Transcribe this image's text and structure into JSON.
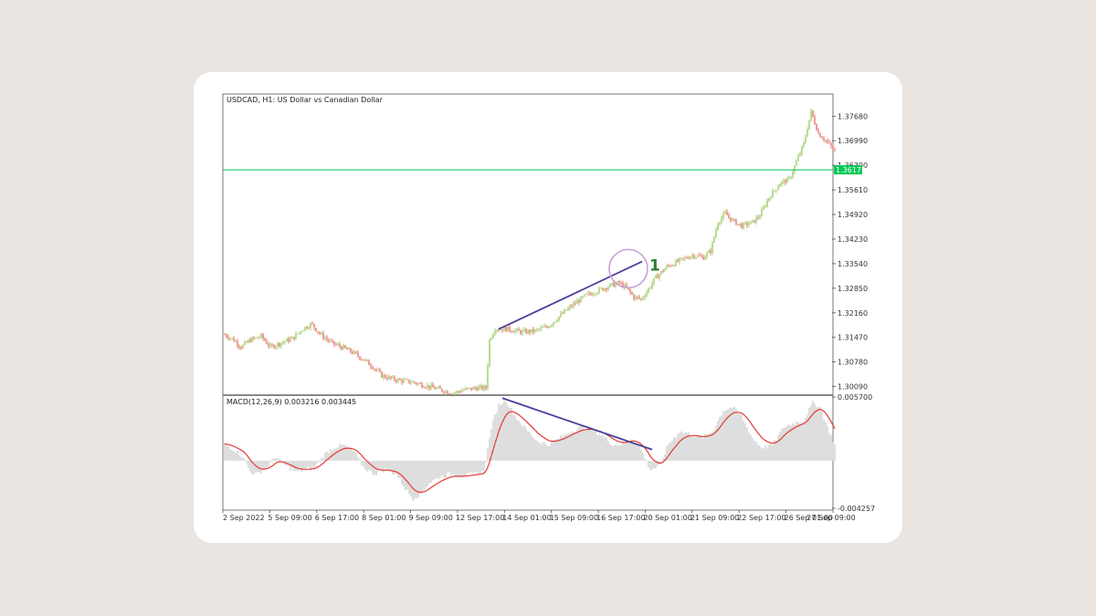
{
  "chart_data": [
    {
      "type": "candlestick",
      "title": "USDCAD, H1:  US Dollar vs Canadian Dollar",
      "ylim": [
        1.299,
        1.382
      ],
      "y_ticks": [
        1.3009,
        1.3078,
        1.3147,
        1.3216,
        1.3285,
        1.3354,
        1.3423,
        1.3492,
        1.3561,
        1.363,
        1.3699,
        1.3768
      ],
      "y_tick_labels": [
        "1.30090",
        "1.30780",
        "1.31470",
        "1.32160",
        "1.32850",
        "1.33540",
        "1.34230",
        "1.34920",
        "1.35610",
        "1.36300",
        "1.36990",
        "1.37680"
      ],
      "horizontal_line": {
        "value": 1.36173,
        "label": "1.36173",
        "color": "#00c853"
      },
      "x_tick_labels": [
        "2 Sep 2022",
        "5 Sep 09:00",
        "6 Sep 17:00",
        "8 Sep 01:00",
        "9 Sep 09:00",
        "12 Sep 17:00",
        "14 Sep 01:00",
        "15 Sep 09:00",
        "16 Sep 17:00",
        "20 Sep 01:00",
        "21 Sep 09:00",
        "22 Sep 17:00",
        "26 Sep 01:00",
        "27 Sep 09:00"
      ],
      "bull_color": "#8bc34a",
      "bear_color": "#e05d4f",
      "price_path": [
        [
          0,
          1.3155
        ],
        [
          10,
          1.314
        ],
        [
          18,
          1.312
        ],
        [
          28,
          1.314
        ],
        [
          40,
          1.315
        ],
        [
          50,
          1.312
        ],
        [
          60,
          1.313
        ],
        [
          75,
          1.3145
        ],
        [
          85,
          1.317
        ],
        [
          95,
          1.3185
        ],
        [
          105,
          1.3155
        ],
        [
          118,
          1.313
        ],
        [
          128,
          1.312
        ],
        [
          140,
          1.3105
        ],
        [
          152,
          1.3085
        ],
        [
          162,
          1.3065
        ],
        [
          172,
          1.304
        ],
        [
          184,
          1.303
        ],
        [
          196,
          1.3025
        ],
        [
          208,
          1.302
        ],
        [
          222,
          1.301
        ],
        [
          236,
          1.3
        ],
        [
          250,
          1.299
        ],
        [
          262,
          1.3
        ],
        [
          276,
          1.3005
        ],
        [
          286,
          1.3005
        ],
        [
          290,
          1.314
        ],
        [
          296,
          1.3172
        ],
        [
          310,
          1.317
        ],
        [
          325,
          1.3162
        ],
        [
          340,
          1.3165
        ],
        [
          355,
          1.318
        ],
        [
          368,
          1.321
        ],
        [
          382,
          1.324
        ],
        [
          396,
          1.3265
        ],
        [
          410,
          1.328
        ],
        [
          422,
          1.3292
        ],
        [
          432,
          1.33
        ],
        [
          440,
          1.3285
        ],
        [
          448,
          1.326
        ],
        [
          456,
          1.3255
        ],
        [
          462,
          1.3275
        ],
        [
          472,
          1.3315
        ],
        [
          484,
          1.3345
        ],
        [
          498,
          1.3362
        ],
        [
          512,
          1.3378
        ],
        [
          524,
          1.3372
        ],
        [
          532,
          1.339
        ],
        [
          540,
          1.347
        ],
        [
          548,
          1.3495
        ],
        [
          556,
          1.3475
        ],
        [
          566,
          1.346
        ],
        [
          578,
          1.347
        ],
        [
          586,
          1.349
        ],
        [
          596,
          1.354
        ],
        [
          608,
          1.358
        ],
        [
          618,
          1.359
        ],
        [
          626,
          1.364
        ],
        [
          634,
          1.369
        ],
        [
          642,
          1.378
        ],
        [
          650,
          1.372
        ],
        [
          658,
          1.37
        ],
        [
          668,
          1.367
        ]
      ],
      "trendline": {
        "color": "#4a3f9a",
        "from": [
          300,
          1.317
        ],
        "to": [
          457,
          1.336
        ]
      },
      "highlight_circle": {
        "color": "#c9a0d6",
        "center": [
          442,
          1.334
        ],
        "radius_price": 0.0048
      },
      "annotation": {
        "text": "1",
        "color": "#2e7d32"
      }
    },
    {
      "type": "macd",
      "label": "MACD(12,26,9) 0.003216 0.003445",
      "ylim": [
        -0.004257,
        0.0057
      ],
      "y_ticks": [
        0.0057,
        -0.004257
      ],
      "y_tick_labels": [
        "0.005700",
        "-0.004257"
      ],
      "histogram_color": "#c8c8c8",
      "signal_color": "#e53935",
      "macd_path": [
        [
          0,
          0.0015
        ],
        [
          10,
          0.001
        ],
        [
          20,
          0.0004
        ],
        [
          28,
          -0.001
        ],
        [
          36,
          -0.0012
        ],
        [
          46,
          -0.0006
        ],
        [
          56,
          0.0004
        ],
        [
          66,
          -0.0004
        ],
        [
          78,
          -0.001
        ],
        [
          88,
          -0.0008
        ],
        [
          98,
          -0.0006
        ],
        [
          110,
          0.0006
        ],
        [
          120,
          0.0012
        ],
        [
          130,
          0.0014
        ],
        [
          142,
          0.0008
        ],
        [
          152,
          -0.0006
        ],
        [
          164,
          -0.0012
        ],
        [
          176,
          -0.0008
        ],
        [
          188,
          -0.0012
        ],
        [
          198,
          -0.0025
        ],
        [
          206,
          -0.0034
        ],
        [
          214,
          -0.003
        ],
        [
          224,
          -0.002
        ],
        [
          234,
          -0.0015
        ],
        [
          246,
          -0.0012
        ],
        [
          258,
          -0.0014
        ],
        [
          272,
          -0.0012
        ],
        [
          284,
          -0.001
        ],
        [
          292,
          0.003
        ],
        [
          300,
          0.005
        ],
        [
          308,
          0.0054
        ],
        [
          318,
          0.004
        ],
        [
          330,
          0.0028
        ],
        [
          342,
          0.0018
        ],
        [
          354,
          0.0014
        ],
        [
          366,
          0.002
        ],
        [
          378,
          0.0026
        ],
        [
          390,
          0.003
        ],
        [
          402,
          0.0028
        ],
        [
          414,
          0.0022
        ],
        [
          426,
          0.0014
        ],
        [
          436,
          0.0015
        ],
        [
          446,
          0.002
        ],
        [
          456,
          0.001
        ],
        [
          466,
          -0.0008
        ],
        [
          476,
          -0.0005
        ],
        [
          486,
          0.0015
        ],
        [
          498,
          0.0026
        ],
        [
          510,
          0.0024
        ],
        [
          522,
          0.002
        ],
        [
          534,
          0.0026
        ],
        [
          546,
          0.0045
        ],
        [
          556,
          0.0048
        ],
        [
          566,
          0.004
        ],
        [
          578,
          0.002
        ],
        [
          588,
          0.0012
        ],
        [
          600,
          0.0014
        ],
        [
          612,
          0.003
        ],
        [
          624,
          0.0034
        ],
        [
          634,
          0.0036
        ],
        [
          644,
          0.0052
        ],
        [
          652,
          0.0048
        ],
        [
          660,
          0.003
        ],
        [
          668,
          0.0014
        ]
      ],
      "trendline": {
        "color": "#4a3f9a",
        "from": [
          304,
          0.0056
        ],
        "to": [
          468,
          0.001
        ]
      }
    }
  ]
}
